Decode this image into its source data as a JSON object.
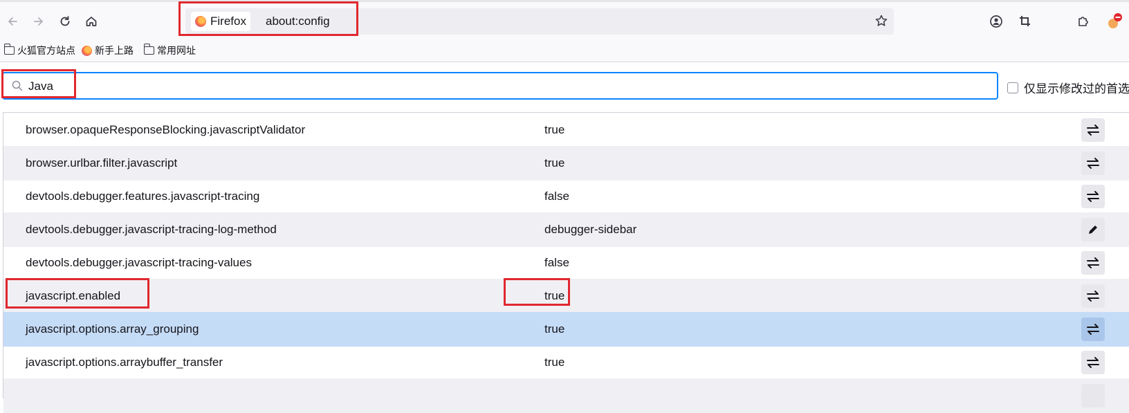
{
  "browser": {
    "identity_label": "Firefox",
    "url": "about:config"
  },
  "bookmarks": [
    {
      "label": "火狐官方站点",
      "icon": "folder-icon"
    },
    {
      "label": "新手上路",
      "icon": "firefox-icon"
    },
    {
      "label": "常用网址",
      "icon": "folder-icon"
    }
  ],
  "search": {
    "value": "Java",
    "placeholder": ""
  },
  "show_modified_label": "仅显示修改过的首选",
  "prefs": [
    {
      "name": "browser.opaqueResponseBlocking.javascriptValidator",
      "value": "true",
      "action": "toggle-icon"
    },
    {
      "name": "browser.urlbar.filter.javascript",
      "value": "true",
      "action": "toggle-icon"
    },
    {
      "name": "devtools.debugger.features.javascript-tracing",
      "value": "false",
      "action": "toggle-icon"
    },
    {
      "name": "devtools.debugger.javascript-tracing-log-method",
      "value": "debugger-sidebar",
      "action": "edit-pencil-icon"
    },
    {
      "name": "devtools.debugger.javascript-tracing-values",
      "value": "false",
      "action": "toggle-icon"
    },
    {
      "name": "javascript.enabled",
      "value": "true",
      "action": "toggle-icon"
    },
    {
      "name": "javascript.options.array_grouping",
      "value": "true",
      "action": "toggle-icon",
      "selected": true
    },
    {
      "name": "javascript.options.arraybuffer_transfer",
      "value": "true",
      "action": "toggle-icon"
    }
  ],
  "colors": {
    "highlight_box": "#e0282e",
    "focus_ring": "#0a84ff",
    "selected_row": "#c5dcf7"
  }
}
